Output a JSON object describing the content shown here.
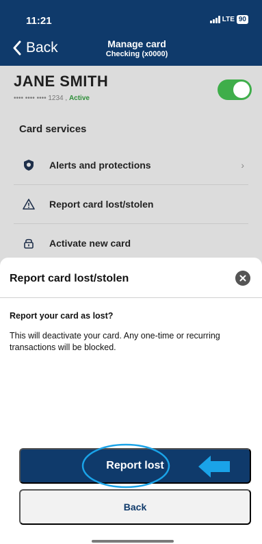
{
  "status_bar": {
    "time": "11:21",
    "network": "LTE",
    "battery": "90"
  },
  "header": {
    "back_label": "Back",
    "title": "Manage card",
    "subtitle": "Checking (x0000)"
  },
  "card": {
    "holder_name": "JANE SMITH",
    "masked_number": "•••• •••• •••• 1234 ,",
    "status": "Active",
    "enabled": true
  },
  "card_services": {
    "title": "Card services",
    "items": [
      {
        "label": "Alerts and protections",
        "icon": "shield-icon",
        "has_chevron": true
      },
      {
        "label": "Report card lost/stolen",
        "icon": "warning-icon"
      },
      {
        "label": "Activate new card",
        "icon": "lock-icon"
      }
    ]
  },
  "sheet": {
    "title": "Report card lost/stolen",
    "question": "Report your card as lost?",
    "description": "This will deactivate your card. Any one-time or recurring transactions will be blocked.",
    "primary_button": "Report lost",
    "secondary_button": "Back"
  },
  "colors": {
    "brand_blue": "#0f3a6b",
    "active_green": "#3fae4a",
    "highlight_cyan": "#1aa3e8"
  }
}
